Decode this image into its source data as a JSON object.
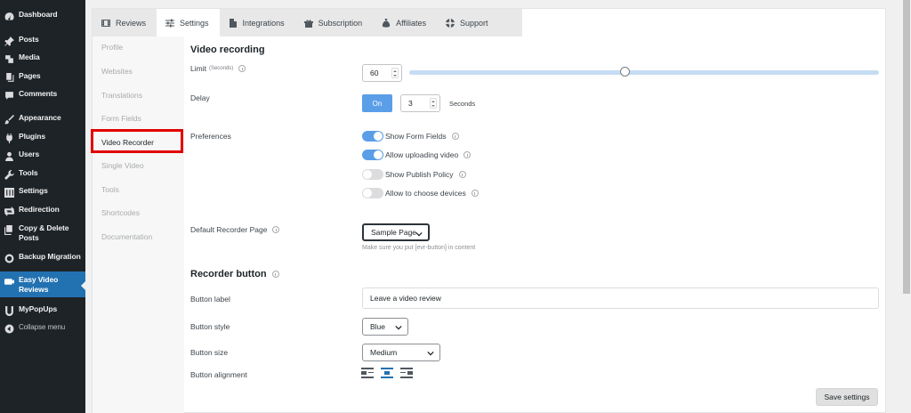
{
  "wp_menu": {
    "dashboard": "Dashboard",
    "posts": "Posts",
    "media": "Media",
    "pages": "Pages",
    "comments": "Comments",
    "appearance": "Appearance",
    "plugins": "Plugins",
    "users": "Users",
    "tools": "Tools",
    "settings": "Settings",
    "redirection": "Redirection",
    "copy_delete": "Copy & Delete Posts",
    "backup": "Backup Migration",
    "easy_video": "Easy Video Reviews",
    "mypopups": "MyPopUps",
    "collapse": "Collapse menu"
  },
  "tabs": {
    "reviews": "Reviews",
    "settings": "Settings",
    "integrations": "Integrations",
    "subscription": "Subscription",
    "affiliates": "Affiliates",
    "support": "Support"
  },
  "settings_menu": {
    "profile": "Profile",
    "websites": "Websites",
    "translations": "Translations",
    "form_fields": "Form Fields",
    "video_recorder": "Video Recorder",
    "single_video": "Single Video",
    "tools": "Tools",
    "shortcodes": "Shortcodes",
    "documentation": "Documentation"
  },
  "video_recording": {
    "title": "Video recording",
    "limit_label": "Limit",
    "limit_unit": "(Seconds)",
    "limit_value": "60",
    "limit_fraction": 0.46,
    "delay_label": "Delay",
    "delay_toggle": "On",
    "delay_value": "3",
    "delay_unit": "Seconds",
    "preferences_label": "Preferences",
    "pref_show_form_fields": "Show Form Fields",
    "pref_allow_uploading": "Allow uploading video",
    "pref_show_publish_policy": "Show Publish Policy",
    "pref_allow_choose_devices": "Allow to choose devices",
    "default_page_label": "Default Recorder Page",
    "default_page_value": "Sample Page",
    "default_page_hint": "Make sure you put [evr-button] in content"
  },
  "recorder_button": {
    "title": "Recorder button",
    "label_label": "Button label",
    "label_value": "Leave a video review",
    "style_label": "Button style",
    "style_value": "Blue",
    "size_label": "Button size",
    "size_value": "Medium",
    "alignment_label": "Button alignment"
  },
  "actions": {
    "save": "Save settings"
  }
}
